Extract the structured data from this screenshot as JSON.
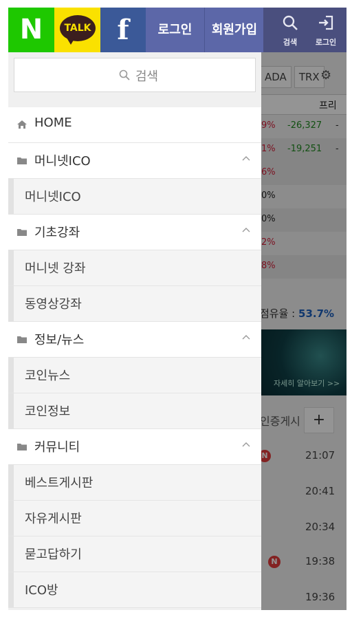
{
  "topbar": {
    "naver_label": "N",
    "kakao_label": "TALK",
    "facebook_label": "f",
    "login_label": "로그인",
    "signup_label": "회원가입",
    "search_icon_label": "검색",
    "login_icon_label": "로그인",
    "colors": {
      "naver": "#1ec800",
      "kakao": "#fae100",
      "facebook": "#3b5998",
      "auth": "#5c67a8"
    }
  },
  "menu": {
    "search_placeholder": "검색",
    "home_label": "HOME",
    "categories": [
      {
        "label": "머니넷ICO",
        "items": [
          "머니넷ICO"
        ]
      },
      {
        "label": "기초강좌",
        "items": [
          "머니넷 강좌",
          "동영상강좌"
        ]
      },
      {
        "label": "정보/뉴스",
        "items": [
          "코인뉴스",
          "코인정보"
        ]
      },
      {
        "label": "커뮤니티",
        "items": [
          "베스트게시판",
          "자유게시판",
          "묻고답하기",
          "ICO방"
        ]
      }
    ]
  },
  "background": {
    "tabs": [
      "ADA",
      "TRX"
    ],
    "column_header": "프리",
    "rows": [
      {
        "pct": "9%",
        "change": "-26,327",
        "dash": "-"
      },
      {
        "pct": "1%",
        "change": "-19,251",
        "dash": "-"
      },
      {
        "pct": "6%"
      },
      {
        "pct": "0%"
      },
      {
        "pct": "0%"
      },
      {
        "pct": "2%"
      },
      {
        "pct": "8%"
      }
    ],
    "share_label": "점유율 :",
    "share_value": "53.7%",
    "banner_text": "자세히 알아보기 >>",
    "cert_label": "인증게시",
    "plus_label": "+",
    "badge_label": "N",
    "times": [
      "21:07",
      "20:41",
      "20:34",
      "19:38",
      "19:36"
    ]
  }
}
